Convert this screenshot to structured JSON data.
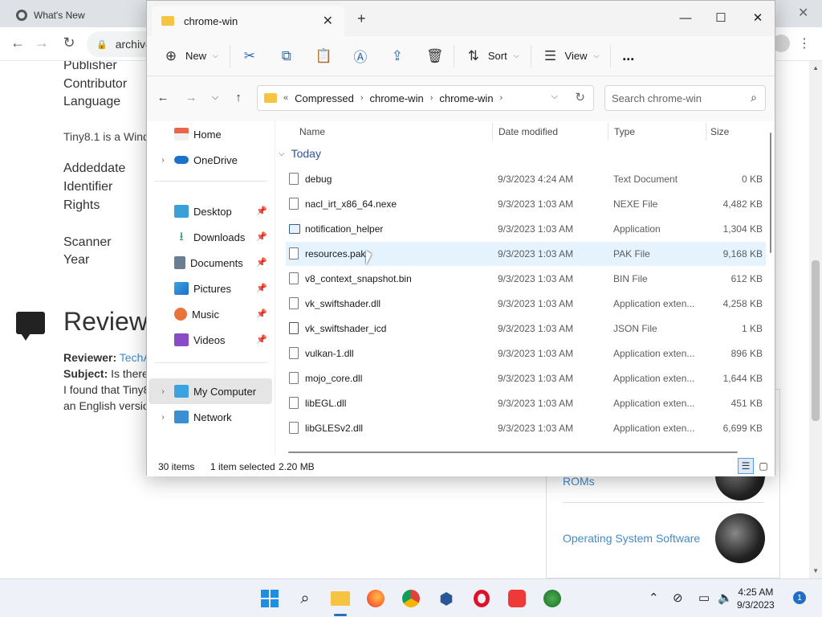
{
  "browser": {
    "tab_title": "What's New",
    "address": "archive",
    "page": {
      "meta_labels": [
        "Publisher",
        "Contributor",
        "Language",
        "Addeddate",
        "Identifier",
        "Rights",
        "Scanner",
        "Year"
      ],
      "description": "Tiny8.1 is a Wind",
      "reviews_title": "Reviews",
      "reviewer_label": "Reviewer:",
      "reviewer_name": "TechA",
      "subject_label": "Subject:",
      "subject_text": "Is there",
      "review_line1": "I found that Tiny8",
      "review_line2": "an English versio",
      "side_links": [
        "ROMs",
        "Operating System Software"
      ]
    }
  },
  "explorer": {
    "tab_title": "chrome-win",
    "command_bar": {
      "new_label": "New",
      "sort_label": "Sort",
      "view_label": "View",
      "more_label": "..."
    },
    "breadcrumb": [
      "Compressed",
      "chrome-win",
      "chrome-win"
    ],
    "search_placeholder": "Search chrome-win",
    "nav": {
      "home": "Home",
      "onedrive": "OneDrive",
      "desktop": "Desktop",
      "downloads": "Downloads",
      "documents": "Documents",
      "pictures": "Pictures",
      "music": "Music",
      "videos": "Videos",
      "my_computer": "My Computer",
      "network": "Network"
    },
    "columns": {
      "name": "Name",
      "date": "Date modified",
      "type": "Type",
      "size": "Size"
    },
    "group": "Today",
    "files": [
      {
        "name": "debug",
        "date": "9/3/2023 4:24 AM",
        "type": "Text Document",
        "size": "0 KB"
      },
      {
        "name": "nacl_irt_x86_64.nexe",
        "date": "9/3/2023 1:03 AM",
        "type": "NEXE File",
        "size": "4,482 KB"
      },
      {
        "name": "notification_helper",
        "date": "9/3/2023 1:03 AM",
        "type": "Application",
        "size": "1,304 KB"
      },
      {
        "name": "resources.pak",
        "date": "9/3/2023 1:03 AM",
        "type": "PAK File",
        "size": "9,168 KB"
      },
      {
        "name": "v8_context_snapshot.bin",
        "date": "9/3/2023 1:03 AM",
        "type": "BIN File",
        "size": "612 KB"
      },
      {
        "name": "vk_swiftshader.dll",
        "date": "9/3/2023 1:03 AM",
        "type": "Application exten...",
        "size": "4,258 KB"
      },
      {
        "name": "vk_swiftshader_icd",
        "date": "9/3/2023 1:03 AM",
        "type": "JSON File",
        "size": "1 KB"
      },
      {
        "name": "vulkan-1.dll",
        "date": "9/3/2023 1:03 AM",
        "type": "Application exten...",
        "size": "896 KB"
      },
      {
        "name": "mojo_core.dll",
        "date": "9/3/2023 1:03 AM",
        "type": "Application exten...",
        "size": "1,644 KB"
      },
      {
        "name": "libEGL.dll",
        "date": "9/3/2023 1:03 AM",
        "type": "Application exten...",
        "size": "451 KB"
      },
      {
        "name": "libGLESv2.dll",
        "date": "9/3/2023 1:03 AM",
        "type": "Application exten...",
        "size": "6,699 KB"
      }
    ],
    "status": {
      "count": "30 items",
      "selected": "1 item selected",
      "size": "2.20 MB"
    }
  },
  "taskbar": {
    "time": "4:25 AM",
    "date": "9/3/2023",
    "notifications": "1"
  }
}
